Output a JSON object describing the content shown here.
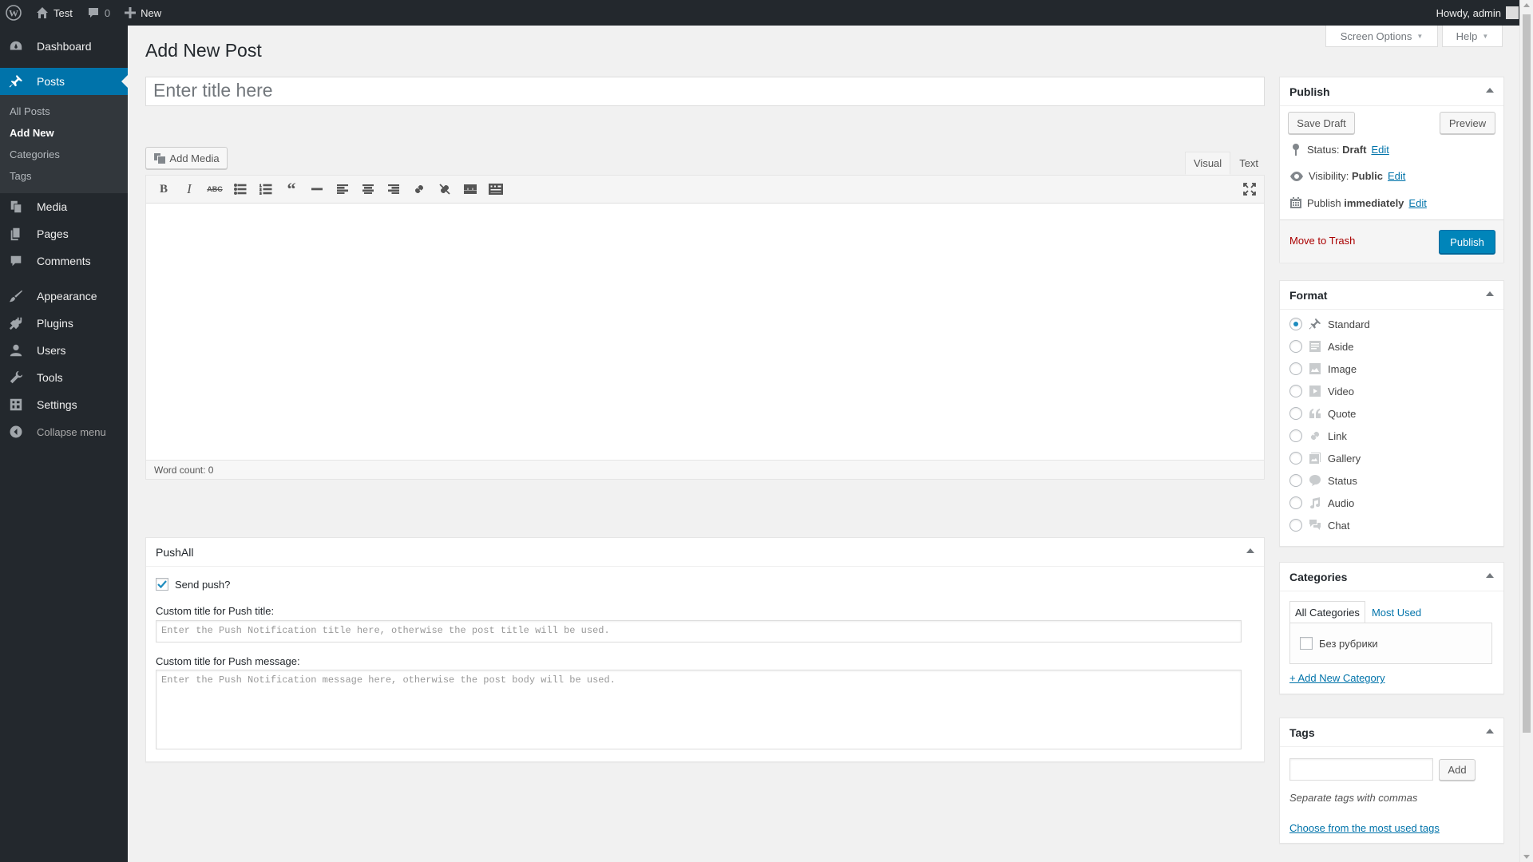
{
  "admin_bar": {
    "site_name": "Test",
    "comments_count": "0",
    "new_label": "New",
    "howdy": "Howdy, admin"
  },
  "menu": {
    "items": [
      {
        "label": "Dashboard",
        "icon": "dashboard-icon"
      },
      {
        "label": "Posts",
        "icon": "pin-icon"
      },
      {
        "label": "Media",
        "icon": "media-icon"
      },
      {
        "label": "Pages",
        "icon": "pages-icon"
      },
      {
        "label": "Comments",
        "icon": "comments-icon"
      },
      {
        "label": "Appearance",
        "icon": "brush-icon"
      },
      {
        "label": "Plugins",
        "icon": "plugins-icon"
      },
      {
        "label": "Users",
        "icon": "users-icon"
      },
      {
        "label": "Tools",
        "icon": "wrench-icon"
      },
      {
        "label": "Settings",
        "icon": "settings-icon"
      }
    ],
    "posts_submenu": [
      "All Posts",
      "Add New",
      "Categories",
      "Tags"
    ],
    "collapse": "Collapse menu"
  },
  "header": {
    "title": "Add New Post",
    "screen_options": "Screen Options",
    "help": "Help"
  },
  "editor": {
    "title_placeholder": "Enter title here",
    "add_media": "Add Media",
    "tab_visual": "Visual",
    "tab_text": "Text",
    "word_count": "Word count: 0"
  },
  "pushall": {
    "title": "PushAll",
    "send_push_label": "Send push?",
    "send_push_checked": true,
    "custom_title_label": "Custom title for Push title:",
    "custom_title_placeholder": "Enter the Push Notification title here, otherwise the post title will be used.",
    "custom_message_label": "Custom title for Push message:",
    "custom_message_placeholder": "Enter the Push Notification message here, otherwise the post body will be used."
  },
  "publish": {
    "title": "Publish",
    "save_draft": "Save Draft",
    "preview": "Preview",
    "status_label": "Status:",
    "status_value": "Draft",
    "visibility_label": "Visibility:",
    "visibility_value": "Public",
    "publish_label": "Publish",
    "publish_value": "immediately",
    "edit": "Edit",
    "move_to_trash": "Move to Trash",
    "publish_button": "Publish"
  },
  "format": {
    "title": "Format",
    "selected": "Standard",
    "options": [
      "Standard",
      "Aside",
      "Image",
      "Video",
      "Quote",
      "Link",
      "Gallery",
      "Status",
      "Audio",
      "Chat"
    ]
  },
  "categories": {
    "title": "Categories",
    "tab_all": "All Categories",
    "tab_most_used": "Most Used",
    "items": [
      "Без рубрики"
    ],
    "add_new": "+ Add New Category"
  },
  "tags": {
    "title": "Tags",
    "add_button": "Add",
    "hint": "Separate tags with commas",
    "choose_link": "Choose from the most used tags"
  },
  "colors": {
    "admin_dark": "#23282d",
    "accent": "#0073aa",
    "publish_button": "#0085ba",
    "trash": "#a00"
  }
}
